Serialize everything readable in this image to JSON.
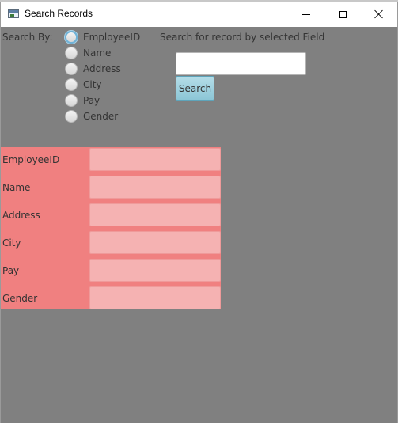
{
  "window": {
    "title": "Search Records",
    "app_icon": "window-app-icon",
    "controls": {
      "minimize": "minimize-icon",
      "maximize": "maximize-icon",
      "close": "close-icon"
    }
  },
  "search": {
    "by_label": "Search By:",
    "hint": "Search for record by selected Field",
    "input_value": "",
    "button_label": "Search",
    "options": [
      {
        "label": "EmployeeID",
        "selected": false,
        "focused": true
      },
      {
        "label": "Name",
        "selected": false,
        "focused": false
      },
      {
        "label": "Address",
        "selected": false,
        "focused": false
      },
      {
        "label": "City",
        "selected": false,
        "focused": false
      },
      {
        "label": "Pay",
        "selected": false,
        "focused": false
      },
      {
        "label": "Gender",
        "selected": false,
        "focused": false
      }
    ]
  },
  "form": {
    "fields": [
      {
        "label": "EmployeeID",
        "value": ""
      },
      {
        "label": "Name",
        "value": ""
      },
      {
        "label": "Address",
        "value": ""
      },
      {
        "label": "City",
        "value": ""
      },
      {
        "label": "Pay",
        "value": ""
      },
      {
        "label": "Gender",
        "value": ""
      }
    ]
  },
  "colors": {
    "background": "#808080",
    "form_panel": "#f08080",
    "form_field": "#f5b2b2",
    "search_button": "#a6d5e2",
    "focus_ring": "#6fb3d8"
  }
}
